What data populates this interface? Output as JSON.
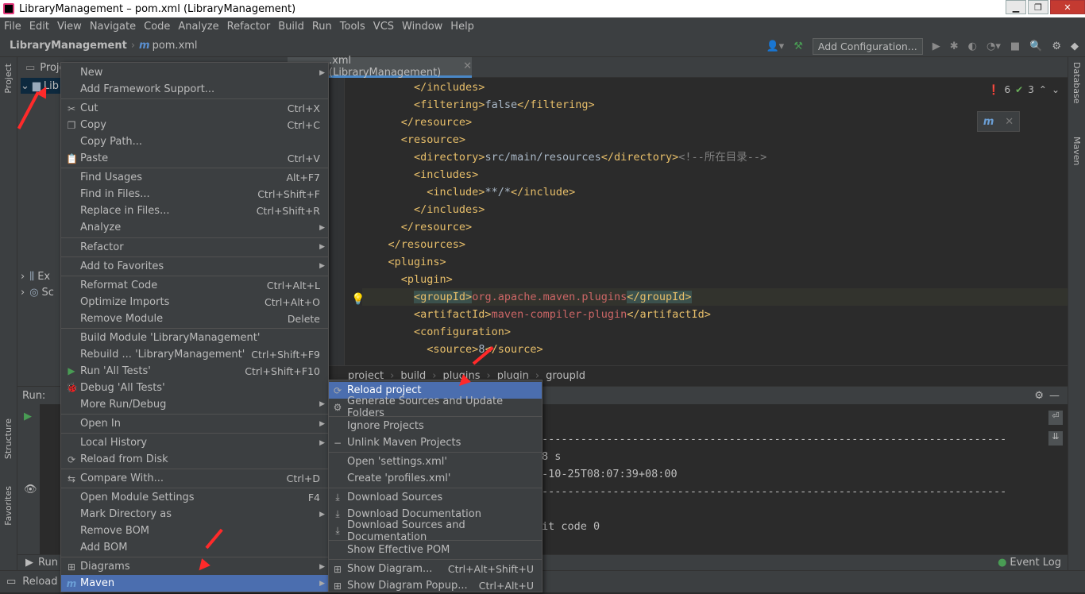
{
  "window": {
    "title": "LibraryManagement – pom.xml (LibraryManagement)"
  },
  "menu": [
    "File",
    "Edit",
    "View",
    "Navigate",
    "Code",
    "Analyze",
    "Refactor",
    "Build",
    "Run",
    "Tools",
    "VCS",
    "Window",
    "Help"
  ],
  "nav": {
    "project": "LibraryManagement",
    "file": "pom.xml",
    "add_config": "Add Configuration..."
  },
  "left_tabs": {
    "project": "Project",
    "structure": "Structure",
    "favorites": "Favorites"
  },
  "right_tabs": {
    "database": "Database",
    "maven": "Maven"
  },
  "project_panel": {
    "header": "Proje",
    "root": "Lib",
    "row_ext": "Ex",
    "row_scratch": "Sc"
  },
  "editor": {
    "tab": ".xml (LibraryManagement)",
    "errors": "6",
    "warnings": "3",
    "lines": [
      {
        "indent": "        ",
        "parts": [
          [
            "tag",
            "</includes>"
          ]
        ]
      },
      {
        "indent": "        ",
        "parts": [
          [
            "tag",
            "<filtering>"
          ],
          [
            "txt",
            "false"
          ],
          [
            "tag",
            "</filtering>"
          ]
        ]
      },
      {
        "indent": "      ",
        "parts": [
          [
            "tag",
            "</resource>"
          ]
        ]
      },
      {
        "indent": "      ",
        "parts": [
          [
            "tag",
            "<resource>"
          ]
        ]
      },
      {
        "indent": "        ",
        "parts": [
          [
            "tag",
            "<directory>"
          ],
          [
            "txt",
            "src/main/resources"
          ],
          [
            "tag",
            "</directory>"
          ],
          [
            "cmt",
            "<!--所在目录-->"
          ]
        ]
      },
      {
        "indent": "        ",
        "parts": [
          [
            "tag",
            "<includes>"
          ]
        ]
      },
      {
        "indent": "          ",
        "parts": [
          [
            "tag",
            "<include>"
          ],
          [
            "txt",
            "**/*"
          ],
          [
            "tag",
            "</include>"
          ]
        ]
      },
      {
        "indent": "        ",
        "parts": [
          [
            "tag",
            "</includes>"
          ]
        ]
      },
      {
        "indent": "      ",
        "parts": [
          [
            "tag",
            "</resource>"
          ]
        ]
      },
      {
        "indent": "    ",
        "parts": [
          [
            "tag",
            "</resources>"
          ]
        ]
      },
      {
        "indent": "    ",
        "parts": [
          [
            "tag",
            "<plugins>"
          ]
        ]
      },
      {
        "indent": "      ",
        "parts": [
          [
            "tag",
            "<plugin>"
          ]
        ]
      },
      {
        "indent": "        ",
        "parts": [
          [
            "tagh",
            "<groupId>"
          ],
          [
            "red",
            "org.apache.maven.plugins"
          ],
          [
            "tagh",
            "</groupId>"
          ]
        ]
      },
      {
        "indent": "        ",
        "parts": [
          [
            "tag",
            "<artifactId>"
          ],
          [
            "red",
            "maven-compiler-plugin"
          ],
          [
            "tag",
            "</artifactId>"
          ]
        ]
      },
      {
        "indent": "        ",
        "parts": [
          [
            "tag",
            "<configuration>"
          ]
        ]
      },
      {
        "indent": "          ",
        "parts": [
          [
            "tag",
            "<source>"
          ],
          [
            "txt",
            "8"
          ],
          [
            "tag",
            "</source>"
          ]
        ]
      }
    ],
    "breadcrumb": [
      "project",
      "build",
      "plugins",
      "plugin",
      "groupId"
    ]
  },
  "run": {
    "label": "Run:",
    "console": [
      "------------------------------------------------------------------------",
      "8 s",
      "-10-25T08:07:39+08:00",
      "------------------------------------------------------------------------",
      "it code 0"
    ]
  },
  "bottom": {
    "run_tab": "Run",
    "event_log": "Event Log",
    "status": "Reload s"
  },
  "context_menu": [
    {
      "label": "New",
      "arrow": true
    },
    {
      "label": "Add Framework Support..."
    },
    {
      "sep": true
    },
    {
      "label": "Cut",
      "shortcut": "Ctrl+X",
      "icon": "✂"
    },
    {
      "label": "Copy",
      "shortcut": "Ctrl+C",
      "icon": "❐"
    },
    {
      "label": "Copy Path..."
    },
    {
      "label": "Paste",
      "shortcut": "Ctrl+V",
      "icon": "📋"
    },
    {
      "sep": true
    },
    {
      "label": "Find Usages",
      "shortcut": "Alt+F7"
    },
    {
      "label": "Find in Files...",
      "shortcut": "Ctrl+Shift+F"
    },
    {
      "label": "Replace in Files...",
      "shortcut": "Ctrl+Shift+R"
    },
    {
      "label": "Analyze",
      "arrow": true
    },
    {
      "sep": true
    },
    {
      "label": "Refactor",
      "arrow": true
    },
    {
      "sep": true
    },
    {
      "label": "Add to Favorites",
      "arrow": true
    },
    {
      "sep": true
    },
    {
      "label": "Reformat Code",
      "shortcut": "Ctrl+Alt+L"
    },
    {
      "label": "Optimize Imports",
      "shortcut": "Ctrl+Alt+O"
    },
    {
      "label": "Remove Module",
      "shortcut": "Delete"
    },
    {
      "sep": true
    },
    {
      "label": "Build Module 'LibraryManagement'"
    },
    {
      "label": "Rebuild ... 'LibraryManagement'",
      "shortcut": "Ctrl+Shift+F9"
    },
    {
      "label": "Run 'All Tests'",
      "shortcut": "Ctrl+Shift+F10",
      "icon": "▶"
    },
    {
      "label": "Debug 'All Tests'",
      "icon": "🐞"
    },
    {
      "label": "More Run/Debug",
      "arrow": true
    },
    {
      "sep": true
    },
    {
      "label": "Open In",
      "arrow": true
    },
    {
      "sep": true
    },
    {
      "label": "Local History",
      "arrow": true
    },
    {
      "label": "Reload from Disk",
      "icon": "⟳"
    },
    {
      "sep": true
    },
    {
      "label": "Compare With...",
      "shortcut": "Ctrl+D",
      "icon": "⇆"
    },
    {
      "sep": true
    },
    {
      "label": "Open Module Settings",
      "shortcut": "F4"
    },
    {
      "label": "Mark Directory as",
      "arrow": true
    },
    {
      "label": "Remove BOM"
    },
    {
      "label": "Add BOM"
    },
    {
      "sep": true
    },
    {
      "label": "Diagrams",
      "arrow": true,
      "icon": "⊞"
    },
    {
      "label": "Maven",
      "arrow": true,
      "icon": "m",
      "selected": true
    }
  ],
  "maven_submenu": [
    {
      "label": "Reload project",
      "icon": "⟳",
      "selected": true
    },
    {
      "label": "Generate Sources and Update Folders",
      "icon": "⚙"
    },
    {
      "sep": true
    },
    {
      "label": "Ignore Projects"
    },
    {
      "label": "Unlink Maven Projects",
      "icon": "−"
    },
    {
      "sep": true
    },
    {
      "label": "Open 'settings.xml'"
    },
    {
      "label": "Create 'profiles.xml'"
    },
    {
      "sep": true
    },
    {
      "label": "Download Sources",
      "icon": "⤓"
    },
    {
      "label": "Download Documentation",
      "icon": "⤓"
    },
    {
      "label": "Download Sources and Documentation",
      "icon": "⤓"
    },
    {
      "sep": true
    },
    {
      "label": "Show Effective POM"
    },
    {
      "sep": true
    },
    {
      "label": "Show Diagram...",
      "shortcut": "Ctrl+Alt+Shift+U",
      "icon": "⊞"
    },
    {
      "label": "Show Diagram Popup...",
      "shortcut": "Ctrl+Alt+U",
      "icon": "⊞"
    }
  ],
  "colors": {
    "accent": "#4b6eaf",
    "arrow": "#ff2a2a"
  }
}
